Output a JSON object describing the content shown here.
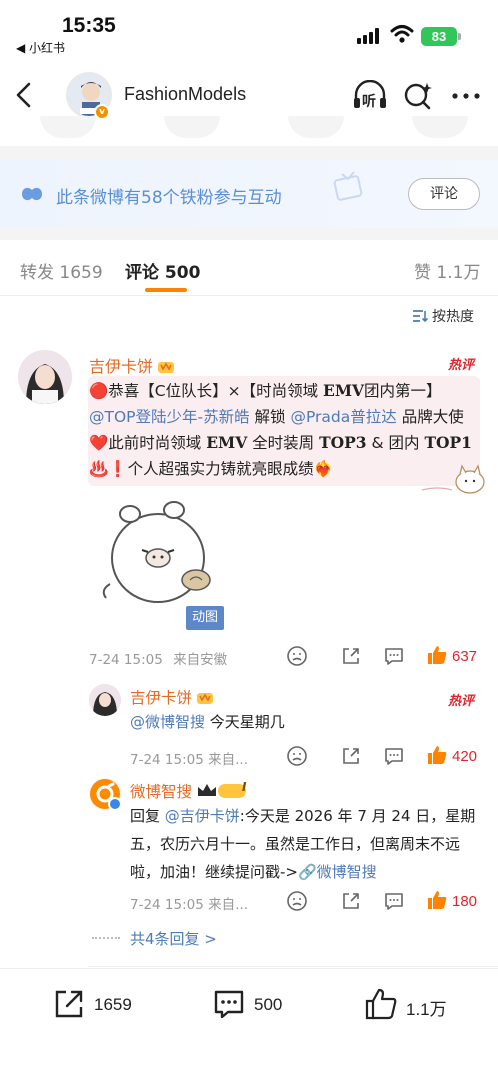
{
  "status_bar": {
    "time": "15:35",
    "back_app": "◀ 小红书",
    "battery": "83"
  },
  "nav": {
    "title": "FashionModels",
    "listen_label": "听",
    "icons": [
      "back-icon",
      "listen-icon",
      "ai-search-icon",
      "more-icon"
    ]
  },
  "banner": {
    "text": "此条微博有58个铁粉参与互动",
    "button": "评论",
    "color": "#5a8fd8"
  },
  "tabs": {
    "repost": "转发",
    "repost_count": "1659",
    "comment": "评论",
    "comment_count": "500",
    "like": "赞",
    "like_count": "1.1万",
    "accent": "#ff8200"
  },
  "sort_label": "按热度",
  "comment": {
    "user": "吉伊卡饼",
    "hot_badge": "热评",
    "text_parts": {
      "p1": "🔴恭喜【C位队长】×【时尚领域 ",
      "p1b": "EMV",
      "p1c": "团内第一】",
      "mention1": "@TOP登陆少年-苏新皓",
      "p2": " 解锁 ",
      "mention2": "@Prada普拉达",
      "p3": " 品牌大使❤️此前时尚领域 ",
      "p3b": "EMV",
      "p3c": " 全时装周 ",
      "p3d": "TOP3",
      "p3e": " & 团内 ",
      "p3f": "TOP1",
      "p4": "♨️❗个人超强实力铸就亮眼成绩❤️‍🔥"
    },
    "sticker_tag": "动图",
    "time": "7-24 15:05",
    "source": "来自安徽",
    "likes": "637"
  },
  "replies": [
    {
      "user": "吉伊卡饼",
      "hot_badge": "热评",
      "mention": "@微博智搜",
      "text": " 今天星期几",
      "meta": "7-24 15:05  来自...",
      "likes": "420"
    },
    {
      "user": "微博智搜",
      "level": "I",
      "prefix": "回复 ",
      "mention": "@吉伊卡饼",
      "text": ":今天是 2026 年 7 月 24 日，星期五，农历六月十一。虽然是工作日，但离周末不远啦，加油！继续提问戳->",
      "link": "🔗微博智搜",
      "meta": "7-24 15:05  来自...",
      "likes": "180"
    }
  ],
  "more_replies": "共4条回复 >",
  "bottom_bar": {
    "repost": "1659",
    "comment": "500",
    "like": "1.1万"
  }
}
